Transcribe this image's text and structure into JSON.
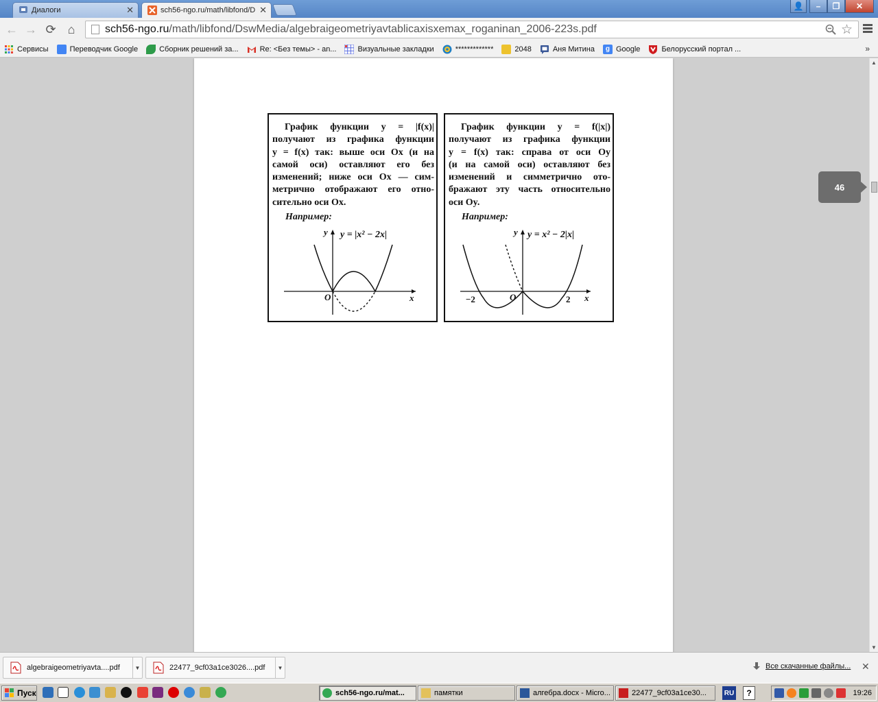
{
  "tabs": [
    {
      "label": "Диалоги",
      "active": false
    },
    {
      "label": "sch56-ngo.ru/math/libfond/D",
      "active": true
    }
  ],
  "window_controls": {
    "user": "👤",
    "minimize": "–",
    "restore": "❐",
    "close": "✕"
  },
  "nav": {
    "back": "←",
    "forward": "→",
    "reload": "⟳",
    "home": "⌂"
  },
  "address": {
    "domain": "sch56-ngo.ru",
    "path": "/math/libfond/DswMedia/algebraigeometriyavtablicaxisxemax_roganinan_2006-223s.pdf"
  },
  "bookmarks": [
    {
      "label": "Сервисы",
      "icon": "apps-icon",
      "color": "#e94235"
    },
    {
      "label": "Переводчик Google",
      "icon": "translate-icon",
      "color": "#4285f4"
    },
    {
      "label": "Сборник решений за...",
      "icon": "leaf-icon",
      "color": "#2e9b4a"
    },
    {
      "label": "Re: <Без темы> - an...",
      "icon": "gmail-icon",
      "color": "#d93025"
    },
    {
      "label": "Визуальные закладки",
      "icon": "grid-icon",
      "color": "#5b6ee1"
    },
    {
      "label": "*************",
      "icon": "target-icon",
      "color": "#1f7fc4"
    },
    {
      "label": "2048",
      "icon": "game-icon",
      "color": "#edc22e"
    },
    {
      "label": "Аня Митина",
      "icon": "chat-icon",
      "color": "#3b5998"
    },
    {
      "label": "Google",
      "icon": "google-icon",
      "color": "#4285f4"
    },
    {
      "label": "Белорусский портал ...",
      "icon": "shield-icon",
      "color": "#d01c1f"
    }
  ],
  "bookmarks_more": "»",
  "pdf": {
    "left_box": {
      "lines": [
        "График функции y = |f(x)|",
        "получают из графика функции",
        "y = f(x) так: выше оси Ox (и на",
        "самой оси) оставляют его без",
        "изменений; ниже оси Ox — сим-",
        "метрично отображают его отно-",
        "сительно оси Ox."
      ],
      "example": "Например:",
      "formula": "y = |x² − 2x|",
      "axis_y": "y",
      "axis_x": "x",
      "origin": "O"
    },
    "right_box": {
      "lines": [
        "График функции y = f(|x|)",
        "получают из графика функции",
        "y = f(x) так: справа от оси Oy",
        "(и на самой оси) оставляют без",
        "изменений и симметрично ото-",
        "бражают эту часть относительно",
        "оси Oy."
      ],
      "example": "Например:",
      "formula": "y = x² − 2|x|",
      "axis_y": "y",
      "axis_x": "x",
      "origin": "O",
      "tick_neg": "−2",
      "tick_pos": "2"
    }
  },
  "page_number": "46",
  "downloads": {
    "items": [
      {
        "name": "algebraigeometriyavta....pdf"
      },
      {
        "name": "22477_9cf03a1ce3026....pdf"
      }
    ],
    "all_label": "Все скачанные файлы...",
    "close": "✕"
  },
  "taskbar": {
    "start_label": "Пуск",
    "buttons": [
      {
        "label": "sch56-ngo.ru/mat...",
        "active": true,
        "icon": "chrome-icon"
      },
      {
        "label": "памятки",
        "active": false,
        "icon": "folder-icon"
      },
      {
        "label": "алгебра.docx - Micro...",
        "active": false,
        "icon": "word-icon"
      },
      {
        "label": "22477_9cf03a1ce30...",
        "active": false,
        "icon": "pdf-icon"
      }
    ],
    "lang": "RU",
    "help": "?",
    "clock": "19:26"
  }
}
